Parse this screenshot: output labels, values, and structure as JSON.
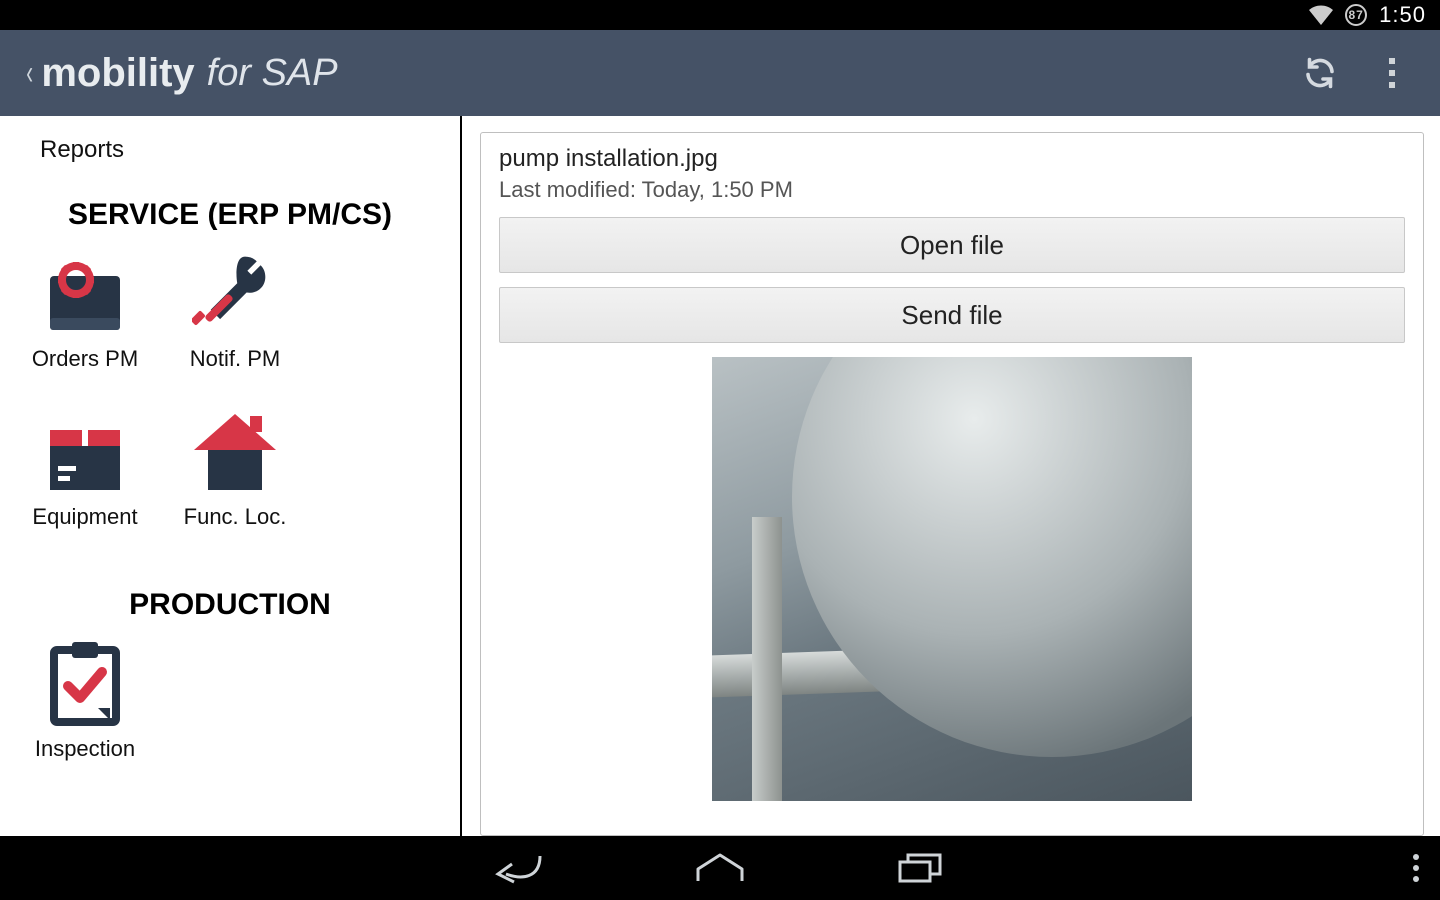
{
  "status": {
    "battery": "87",
    "time": "1:50"
  },
  "appbar": {
    "brand": "mobility",
    "brand_sub": "for SAP"
  },
  "sidebar": {
    "top_link": "Reports",
    "section_service": "SERVICE (ERP PM/CS)",
    "section_production": "PRODUCTION",
    "tiles": {
      "orders_pm": "Orders PM",
      "notif_pm": "Notif. PM",
      "equipment": "Equipment",
      "func_loc": "Func. Loc.",
      "inspection": "Inspection"
    }
  },
  "file": {
    "name": "pump installation.jpg",
    "modified": "Last modified: Today, 1:50 PM",
    "open_label": "Open file",
    "send_label": "Send file"
  }
}
